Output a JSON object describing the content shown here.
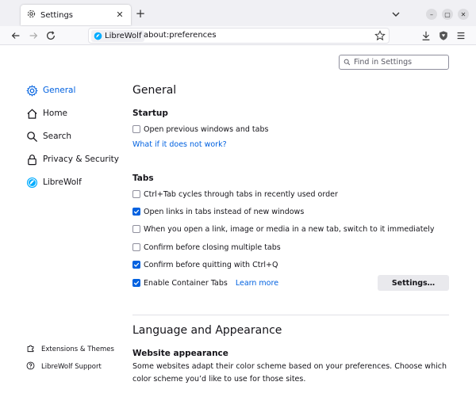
{
  "browser": {
    "tab_title": "Settings",
    "url_identity": "LibreWolf",
    "url": "about:preferences"
  },
  "search": {
    "placeholder": "Find in Settings"
  },
  "sidebar": {
    "items": [
      {
        "label": "General",
        "icon": "gear-icon",
        "selected": true
      },
      {
        "label": "Home",
        "icon": "home-icon"
      },
      {
        "label": "Search",
        "icon": "search-icon"
      },
      {
        "label": "Privacy & Security",
        "icon": "lock-icon"
      },
      {
        "label": "LibreWolf",
        "icon": "librewolf-icon"
      }
    ],
    "footer": [
      {
        "label": "Extensions & Themes",
        "icon": "puzzle-icon"
      },
      {
        "label": "LibreWolf Support",
        "icon": "help-icon"
      }
    ]
  },
  "main": {
    "title": "General",
    "startup": {
      "heading": "Startup",
      "restore_label": "Open previous windows and tabs",
      "restore_checked": false,
      "help_link": "What if it does not work?"
    },
    "tabs": {
      "heading": "Tabs",
      "options": [
        {
          "label": "Ctrl+Tab cycles through tabs in recently used order",
          "checked": false
        },
        {
          "label": "Open links in tabs instead of new windows",
          "checked": true
        },
        {
          "label": "When you open a link, image or media in a new tab, switch to it immediately",
          "checked": false
        },
        {
          "label": "Confirm before closing multiple tabs",
          "checked": false
        },
        {
          "label": "Confirm before quitting with Ctrl+Q",
          "checked": true
        },
        {
          "label": "Enable Container Tabs",
          "checked": true
        }
      ],
      "learn_more": "Learn more",
      "settings_button": "Settings…"
    },
    "language": {
      "title": "Language and Appearance",
      "website_appearance_heading": "Website appearance",
      "website_appearance_desc": "Some websites adapt their color scheme based on your preferences. Choose which color scheme you’d like to use for those sites."
    }
  },
  "colors": {
    "accent": "#0061e0",
    "text": "#15141a"
  }
}
